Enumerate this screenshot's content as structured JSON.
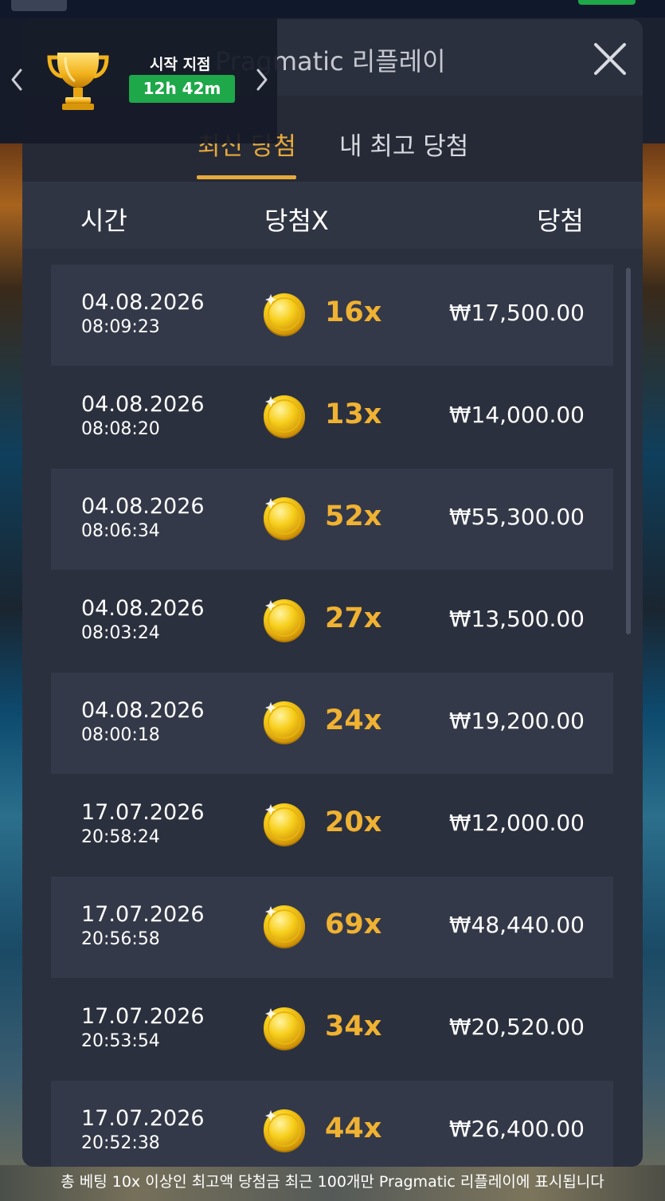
{
  "modal": {
    "title": "Pragmatic 리플레이",
    "close_icon": "close-icon"
  },
  "tabs": [
    {
      "label": "최신 당첨",
      "active": true
    },
    {
      "label": "내 최고 당첨",
      "active": false
    }
  ],
  "columns": {
    "time": "시간",
    "multiplier": "당첨X",
    "win": "당첨"
  },
  "rows": [
    {
      "date": "04.08.2026",
      "time": "08:09:23",
      "multiplier": "16x",
      "amount": "₩17,500.00"
    },
    {
      "date": "04.08.2026",
      "time": "08:08:20",
      "multiplier": "13x",
      "amount": "₩14,000.00"
    },
    {
      "date": "04.08.2026",
      "time": "08:06:34",
      "multiplier": "52x",
      "amount": "₩55,300.00"
    },
    {
      "date": "04.08.2026",
      "time": "08:03:24",
      "multiplier": "27x",
      "amount": "₩13,500.00"
    },
    {
      "date": "04.08.2026",
      "time": "08:00:18",
      "multiplier": "24x",
      "amount": "₩19,200.00"
    },
    {
      "date": "17.07.2026",
      "time": "20:58:24",
      "multiplier": "20x",
      "amount": "₩12,000.00"
    },
    {
      "date": "17.07.2026",
      "time": "20:56:58",
      "multiplier": "69x",
      "amount": "₩48,440.00"
    },
    {
      "date": "17.07.2026",
      "time": "20:53:54",
      "multiplier": "34x",
      "amount": "₩20,520.00"
    },
    {
      "date": "17.07.2026",
      "time": "20:52:38",
      "multiplier": "44x",
      "amount": "₩26,400.00"
    }
  ],
  "tournament": {
    "start_label": "시작 지점",
    "countdown": "12h 42m",
    "icon": "trophy-icon"
  },
  "footer": {
    "note": "총 베팅 10x 이상인 최고액 당첨금 최근 100개만 Pragmatic 리플레이에 표시됩니다"
  },
  "colors": {
    "accent": "#e6a93c",
    "multiplier": "#f0b232",
    "badge_green": "#1ea84a",
    "panel": "#2b303e",
    "row_shade": "#343949"
  }
}
